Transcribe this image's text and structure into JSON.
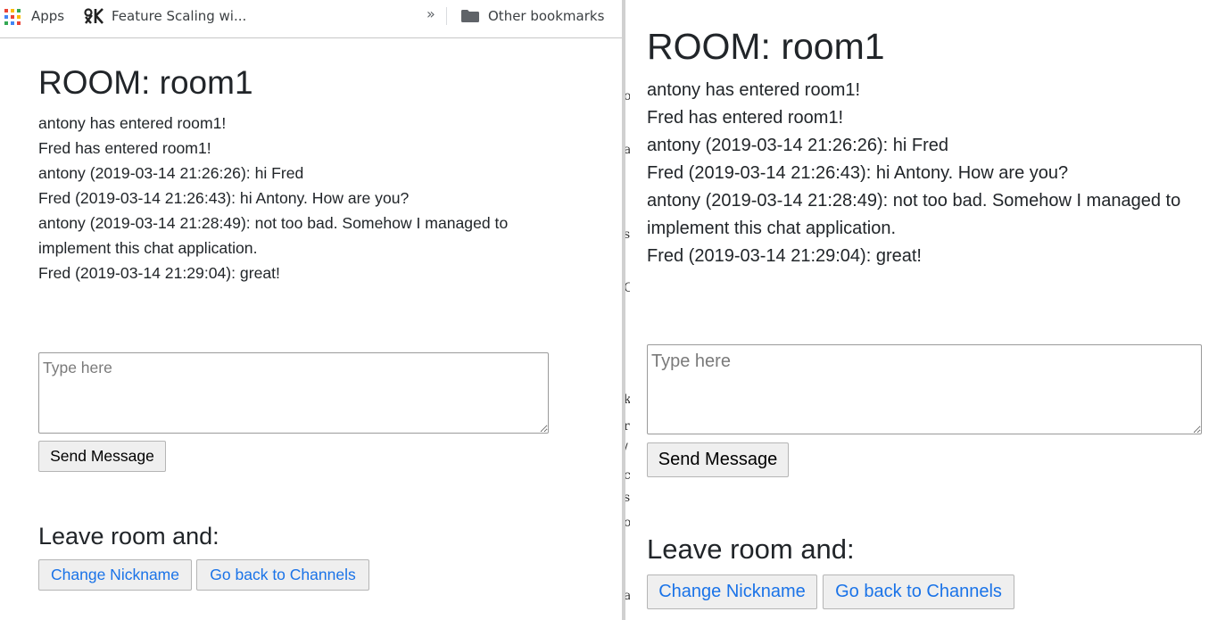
{
  "bookmarks_bar": {
    "apps_label": "Apps",
    "feature_scaling_label": "Feature Scaling wi...",
    "overflow_label": "»",
    "other_bookmarks_label": "Other bookmarks"
  },
  "chat": {
    "room_title": "ROOM: room1",
    "messages": [
      "antony has entered room1!",
      "Fred has entered room1!",
      "antony (2019-03-14 21:26:26): hi Fred",
      "Fred (2019-03-14 21:26:43): hi Antony. How are you?",
      "antony (2019-03-14 21:28:49): not too bad. Somehow I managed to implement this chat application.",
      "Fred (2019-03-14 21:29:04): great!"
    ],
    "input_placeholder": "Type here",
    "send_label": "Send Message",
    "leave_heading": "Leave room and:",
    "change_nickname_label": "Change Nickname",
    "back_to_channels_label": "Go back to Channels"
  },
  "colors": {
    "text": "#212529",
    "link": "#1a73e8",
    "button_bg": "#efefef"
  }
}
